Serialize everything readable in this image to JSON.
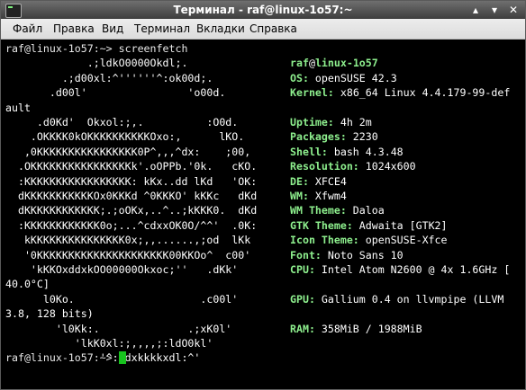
{
  "window": {
    "title": "Терминал - raf@linux-1o57:~",
    "buttons": [
      "▴",
      "▾",
      "✕"
    ]
  },
  "menu": [
    "Файл",
    "Правка",
    "Вид",
    "Терминал",
    "Вкладки",
    "Справка"
  ],
  "prompt": "raf@linux-1o57:~>",
  "command": "screenfetch",
  "logo": [
    "             .;ldkO0000Okdl;.",
    "         .;d00xl:^''''''^:ok00d;.",
    "       .d00l'                'o00d.",
    "",
    "     .d0Kd'  Okxol:;,.          :O0d.",
    "    .OKKKK0kOKKKKKKKKKKOxo:,      lKO.",
    "   ,0KKKKKKKKKKKKKKKK0P^,,,^dx:    ;00,",
    "  .OKKKKKKKKKKKKKKKKk'.oOPPb.'0k.   cKO.",
    "  :KKKKKKKKKKKKKKKKK: kKx..dd lKd   'OK:",
    "  dKKKKKKKKKKKOx0KKKd ^0KKKO' kKKc   dKd",
    "  dKKKKKKKKKKKK;.;oOKx,..^..;kKKK0.  dKd",
    "  :KKKKKKKKKKKK0o;...^cdxxOK0O/^^'  .0K:",
    "   kKKKKKKKKKKKKKKK0x;,,......,;od  lKk",
    "   '0KKKKKKKKKKKKKKKKKKKKK00KKOo^  c00'",
    "    'kKKOxddxkOO00000Okxoc;''   .dKk'",
    "",
    "      l0Ko.                    .c00l'",
    "",
    "        'l0Kk:.              .;xK0l'",
    "           'lkK0xl:;,,,,;:ldO0kl'",
    "               '^:ldxkkkkxdl:^'"
  ],
  "user_host": {
    "user": "raf",
    "at": "@",
    "host": "linux-1o57"
  },
  "info": [
    {
      "row": 1,
      "label": "OS:",
      "value": " openSUSE 42.3"
    },
    {
      "row": 2,
      "label": "Kernel:",
      "value": " x86_64 Linux 4.4.179-99-def"
    },
    {
      "row": 3,
      "label": "",
      "value": "ault"
    },
    {
      "row": 4,
      "label": "Uptime:",
      "value": " 4h 2m"
    },
    {
      "row": 5,
      "label": "Packages:",
      "value": " 2230"
    },
    {
      "row": 6,
      "label": "Shell:",
      "value": " bash 4.3.48"
    },
    {
      "row": 7,
      "label": "Resolution:",
      "value": " 1024x600"
    },
    {
      "row": 8,
      "label": "DE:",
      "value": " XFCE4"
    },
    {
      "row": 9,
      "label": "WM:",
      "value": " Xfwm4"
    },
    {
      "row": 10,
      "label": "WM Theme:",
      "value": " Daloa"
    },
    {
      "row": 11,
      "label": "GTK Theme:",
      "value": " Adwaita [GTK2]"
    },
    {
      "row": 12,
      "label": "Icon Theme:",
      "value": " openSUSE-Xfce"
    },
    {
      "row": 13,
      "label": "Font:",
      "value": " Noto Sans 10"
    },
    {
      "row": 14,
      "label": "CPU:",
      "value": " Intel Atom N2600 @ 4x 1.6GHz ["
    },
    {
      "row": 15,
      "label": "",
      "value": "40.0°C]"
    },
    {
      "row": 16,
      "label": "GPU:",
      "value": " Gallium 0.4 on llvmpipe (LLVM"
    },
    {
      "row": 17,
      "label": "",
      "value": "3.8, 128 bits)"
    },
    {
      "row": 18,
      "label": "RAM:",
      "value": " 358MiB / 1988MiB"
    }
  ],
  "colors": {
    "accent_green": "#8ef08e",
    "cursor": "#17c21e",
    "background": "#000000"
  }
}
